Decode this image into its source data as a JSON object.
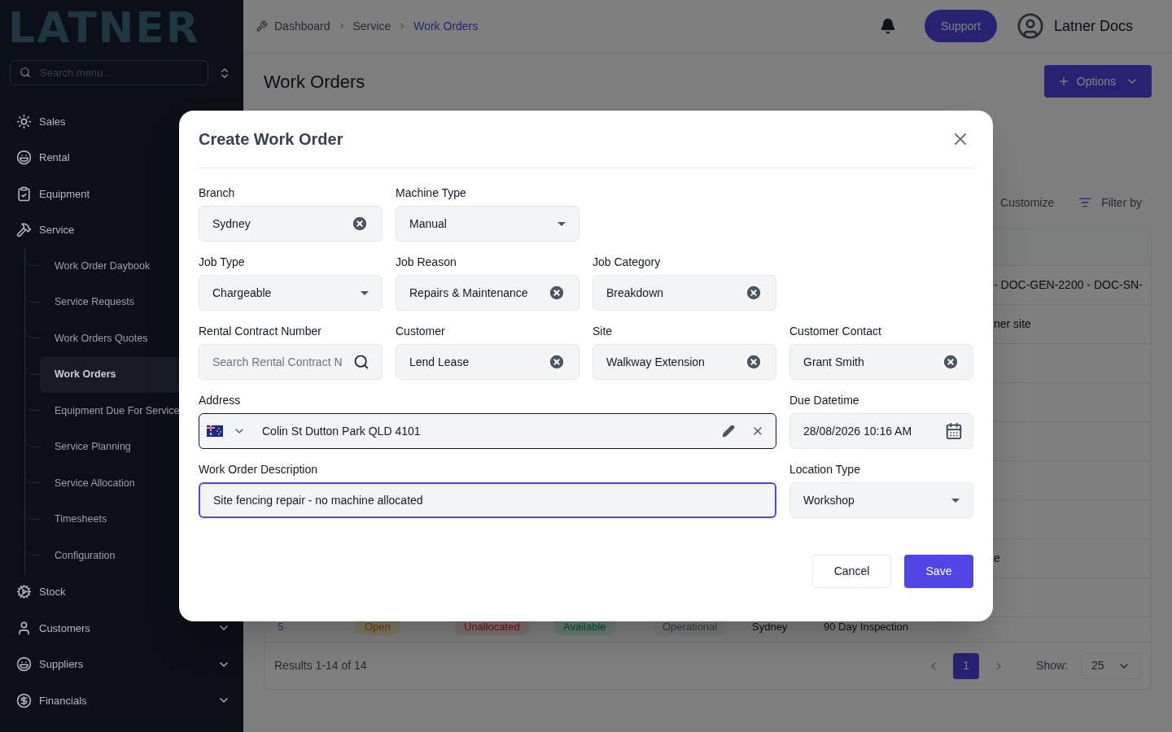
{
  "sidebar": {
    "logo": "LATNER",
    "search": {
      "placeholder": "Search menu..."
    },
    "items": [
      {
        "label": "Sales",
        "kind": "sun",
        "selected": false
      },
      {
        "label": "Rental",
        "kind": "face",
        "selected": false
      },
      {
        "label": "Equipment",
        "kind": "clipboard",
        "selected": false
      },
      {
        "label": "Service",
        "kind": "tools",
        "selected": false,
        "expanded": true,
        "children": [
          {
            "label": "Work Order Daybook",
            "selected": false
          },
          {
            "label": "Service Requests",
            "selected": false
          },
          {
            "label": "Work Orders Quotes",
            "selected": false
          },
          {
            "label": "Work Orders",
            "selected": true
          },
          {
            "label": "Equipment Due For Service",
            "selected": false
          },
          {
            "label": "Service Planning",
            "selected": false
          },
          {
            "label": "Service Allocation",
            "selected": false
          },
          {
            "label": "Timesheets",
            "selected": false
          },
          {
            "label": "Configuration",
            "selected": false
          }
        ]
      },
      {
        "label": "Stock",
        "kind": "cogs",
        "selected": false
      },
      {
        "label": "Customers",
        "kind": "user",
        "selected": false,
        "expanded": false
      },
      {
        "label": "Suppliers",
        "kind": "face",
        "selected": false,
        "expanded": false
      },
      {
        "label": "Financials",
        "kind": "dollar",
        "selected": false,
        "expanded": false
      }
    ]
  },
  "header": {
    "breadcrumbs": [
      "Dashboard",
      "Service",
      "Work Orders"
    ],
    "support_button": "Support",
    "user_name": "Latner Docs"
  },
  "page": {
    "title": "Work Orders",
    "options_button": "Options",
    "toolbar": [
      "Customize",
      "Filter by"
    ],
    "table": {
      "rows": [
        {
          "tail": "- DOC-GEN-2200 - DOC-SN-"
        },
        {
          "tail": "ner site"
        },
        {},
        {},
        {},
        {},
        {},
        {
          "tail": "e"
        },
        {}
      ],
      "last_row": {
        "id": "5",
        "badges": [
          {
            "label": "Open",
            "kind": "warning"
          },
          {
            "label": "Unallocated",
            "kind": "danger"
          },
          {
            "label": "Available",
            "kind": "success"
          },
          {
            "label": "Operational",
            "kind": "neutral"
          }
        ],
        "branch": "Sydney",
        "reason": "90 Day Inspection"
      }
    },
    "footer": {
      "results": "Results 1-14 of 14",
      "pages": [
        {
          "label": "1",
          "selected": true
        }
      ],
      "show_label": "Show:",
      "page_size": "25"
    }
  },
  "dialog": {
    "title": "Create Work Order",
    "rows": [
      [
        {
          "label": "Branch",
          "kind": "clearable",
          "value": "Sydney"
        },
        {
          "label": "Machine Type",
          "kind": "select",
          "value": "Manual"
        }
      ],
      [
        {
          "label": "Job Type",
          "kind": "select",
          "value": "Chargeable"
        },
        {
          "label": "Job Reason",
          "kind": "clearable",
          "value": "Repairs & Maintenance"
        },
        {
          "label": "Job Category",
          "kind": "clearable",
          "value": "Breakdown"
        }
      ],
      [
        {
          "label": "Rental Contract Number",
          "kind": "search",
          "placeholder": "Search Rental Contract N"
        },
        {
          "label": "Customer",
          "kind": "clearable",
          "value": "Lend Lease"
        },
        {
          "label": "Site",
          "kind": "clearable",
          "value": "Walkway Extension"
        },
        {
          "label": "Customer Contact",
          "kind": "clearable",
          "value": "Grant Smith"
        }
      ],
      [
        {
          "label": "Address",
          "kind": "address",
          "value": "Colin St Dutton Park QLD 4101"
        },
        {
          "label": "Due Datetime",
          "kind": "datetime",
          "value": "28/08/2026 10:16 AM"
        }
      ],
      [
        {
          "label": "Work Order Description",
          "kind": "text",
          "value": "Site fencing repair - no machine allocated",
          "focused": true
        },
        {
          "label": "Location Type",
          "kind": "select",
          "value": "Workshop"
        }
      ]
    ],
    "buttons": [
      {
        "label": "Cancel",
        "kind": "secondary"
      },
      {
        "label": "Save",
        "kind": "primary"
      }
    ]
  }
}
